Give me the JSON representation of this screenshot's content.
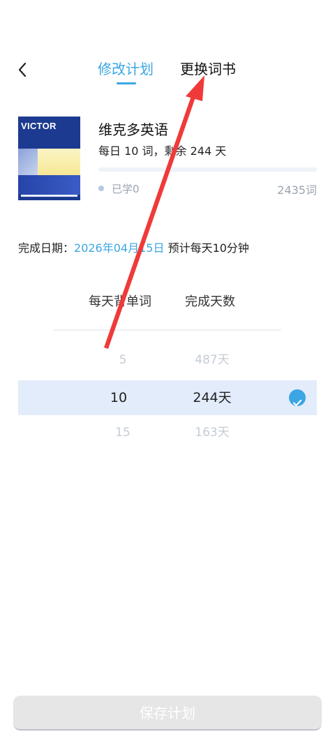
{
  "header": {
    "tabs": [
      {
        "label": "修改计划",
        "active": true
      },
      {
        "label": "更换词书",
        "active": false
      }
    ]
  },
  "book": {
    "cover_brand": "VICTOR",
    "title": "维克多英语",
    "subtitle": "每日 10 词，剩余 244 天",
    "learned_label": "已学0",
    "total_words": "2435词",
    "progress": 0
  },
  "plan": {
    "finish_label": "完成日期：",
    "finish_date": "2026年04月15日",
    "estimate": "预计每天10分钟"
  },
  "picker": {
    "headers": {
      "words": "每天背单词",
      "days": "完成天数"
    },
    "rows": [
      {
        "words": "5",
        "days": "487天",
        "selected": false
      },
      {
        "words": "10",
        "days": "244天",
        "selected": true
      },
      {
        "words": "15",
        "days": "163天",
        "selected": false
      }
    ]
  },
  "footer": {
    "save_label": "保存计划"
  },
  "colors": {
    "accent": "#3ba6e3",
    "selected_row": "#e3ecfa",
    "annotation": "#f03a3a"
  }
}
